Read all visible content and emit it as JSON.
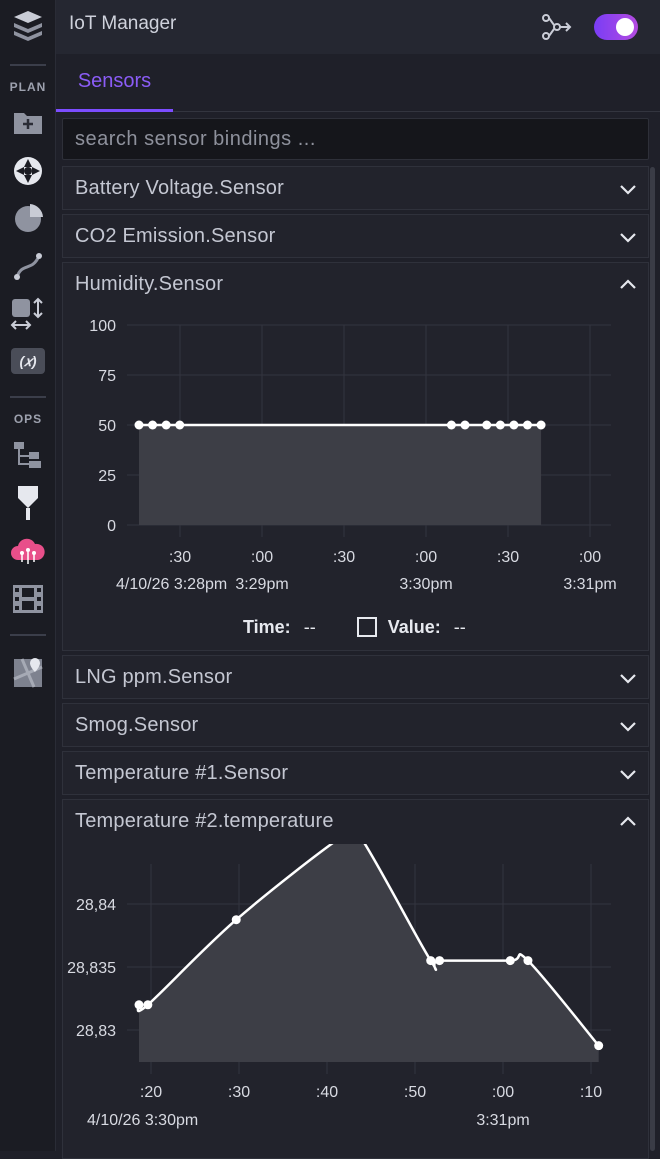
{
  "app": {
    "title": "IoT Manager"
  },
  "sidebar": {
    "plan_label": "PLAN",
    "ops_label": "OPS",
    "plan_items": [
      "add-folder-icon",
      "aperture-icon",
      "pie-chart-icon",
      "curve-icon",
      "resize-icon",
      "variable-icon"
    ],
    "ops_items": [
      "tree-icon",
      "pin-icon",
      "cloud-icon",
      "film-icon",
      "map-icon"
    ]
  },
  "tabs": [
    {
      "label": "Sensors",
      "active": true
    }
  ],
  "search": {
    "placeholder": "search sensor bindings ..."
  },
  "sensors": [
    {
      "label": "Battery Voltage.Sensor",
      "expanded": false
    },
    {
      "label": "CO2 Emission.Sensor",
      "expanded": false
    },
    {
      "label": "Humidity.Sensor",
      "expanded": true
    },
    {
      "label": "LNG ppm.Sensor",
      "expanded": false
    },
    {
      "label": "Smog.Sensor",
      "expanded": false
    },
    {
      "label": "Temperature #1.Sensor",
      "expanded": false
    },
    {
      "label": "Temperature #2.temperature",
      "expanded": true
    }
  ],
  "legend": {
    "time_label": "Time:",
    "time_value": "--",
    "value_label": "Value:",
    "value_value": "--"
  },
  "colors": {
    "accent": "#8b5cf6",
    "toggle": "#9b45ee",
    "line": "#ffffff",
    "area": "#3d3e46"
  },
  "chart_data": [
    {
      "type": "area",
      "series": [
        {
          "values": [
            50,
            50,
            50,
            50,
            50,
            50,
            50,
            50,
            50,
            50,
            50
          ]
        }
      ],
      "x": [
        "3:28:20pm",
        "3:28:25pm",
        "3:28:30pm",
        "3:28:35pm",
        "3:30:15pm",
        "3:30:20pm",
        "3:30:28pm",
        "3:30:33pm",
        "3:30:38pm",
        "3:30:43pm",
        "3:30:48pm"
      ],
      "ylim": [
        0,
        100
      ],
      "yticks": [
        "100",
        "75",
        "50",
        "25",
        "0"
      ],
      "xticks": [
        ":30",
        ":00",
        ":30",
        ":00",
        ":30",
        ":00"
      ],
      "xsub": [
        "4/10/26 3:28pm",
        "3:29pm",
        "3:30pm",
        "3:31pm"
      ],
      "grid": true
    },
    {
      "type": "area",
      "series": [
        {
          "values": [
            28.8315,
            28.8315,
            28.8367,
            28.8418,
            28.8418,
            28.8342,
            28.8342,
            28.8342,
            28.8342,
            28.829
          ]
        }
      ],
      "x": [
        "3:30:19",
        "3:30:20",
        "3:30:30",
        "3:30:42",
        "3:30:44",
        "3:30:52",
        "3:30:53",
        "3:31:01",
        "3:31:03",
        "3:31:11"
      ],
      "ylim": [
        28.828,
        28.845
      ],
      "yticks": [
        "28,84",
        "28,835",
        "28,83"
      ],
      "xticks": [
        ":20",
        ":30",
        ":40",
        ":50",
        ":00",
        ":10"
      ],
      "xsub": [
        "4/10/26 3:30pm",
        "3:31pm"
      ],
      "grid": true
    }
  ]
}
